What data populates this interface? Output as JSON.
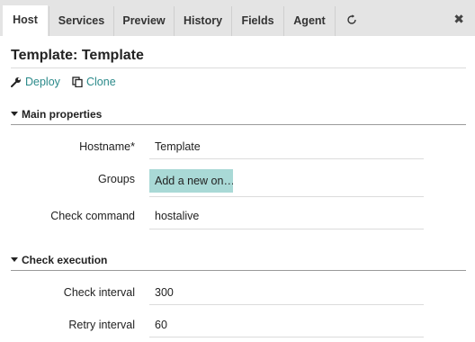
{
  "tabs": [
    {
      "label": "Host",
      "active": true
    },
    {
      "label": "Services"
    },
    {
      "label": "Preview"
    },
    {
      "label": "History"
    },
    {
      "label": "Fields"
    },
    {
      "label": "Agent"
    }
  ],
  "tab_icons": {
    "refresh": "refresh-icon",
    "close": "close-icon"
  },
  "page": {
    "title": "Template: Template"
  },
  "actions": {
    "deploy": "Deploy",
    "clone": "Clone"
  },
  "sections": {
    "main": {
      "title": "Main properties",
      "fields": {
        "hostname": {
          "label": "Hostname*",
          "value": "Template"
        },
        "groups": {
          "label": "Groups",
          "button": "Add a new on…"
        },
        "check_command": {
          "label": "Check command",
          "value": "hostalive"
        }
      }
    },
    "execution": {
      "title": "Check execution",
      "fields": {
        "check_interval": {
          "label": "Check interval",
          "value": "300"
        },
        "retry_interval": {
          "label": "Retry interval",
          "value": "60"
        }
      }
    }
  },
  "colors": {
    "accent": "#2b8a8a",
    "tab_bar": "#e4e4e4",
    "groups_button": "#a9d9d6"
  }
}
